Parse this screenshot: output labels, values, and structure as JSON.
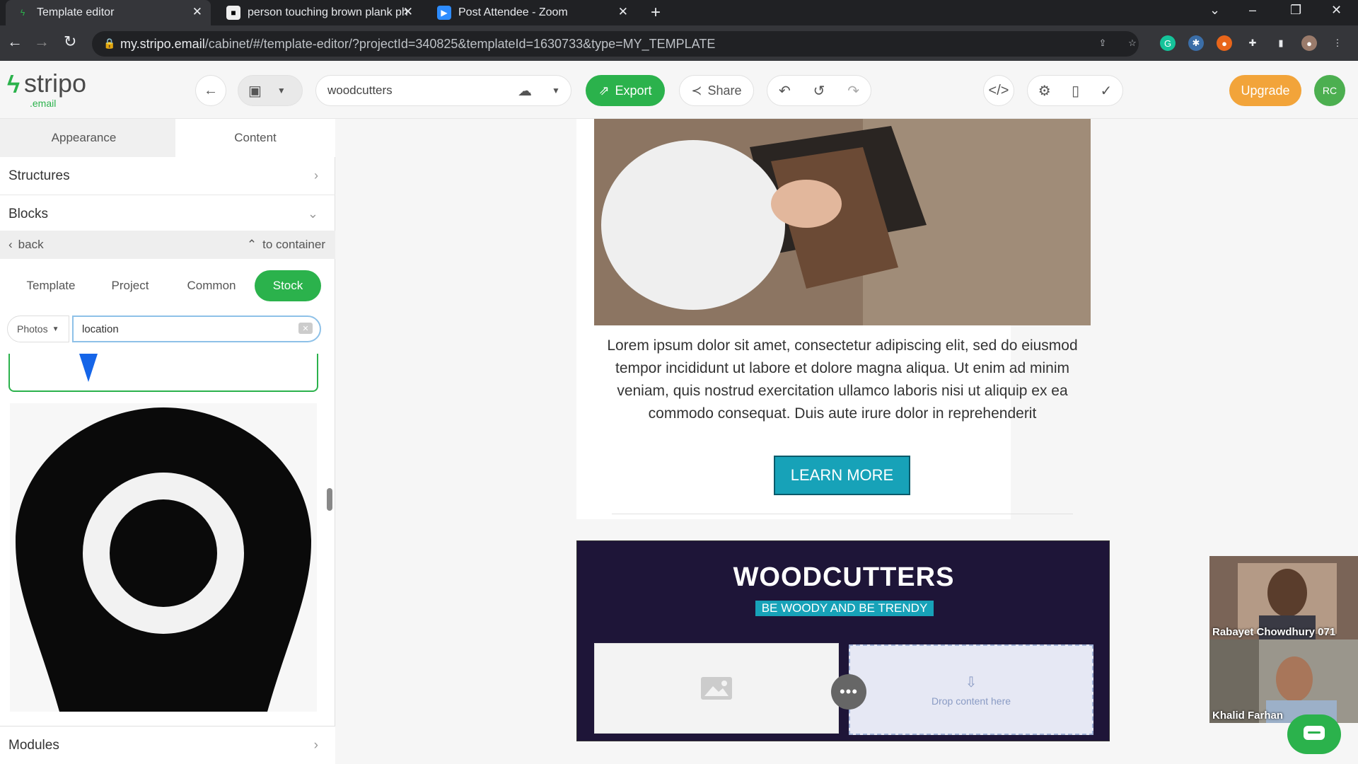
{
  "browser": {
    "tabs": [
      {
        "title": "Template editor",
        "active": true
      },
      {
        "title": "person touching brown plank ph",
        "active": false
      },
      {
        "title": "Post Attendee - Zoom",
        "active": false
      }
    ],
    "url_host": "my.stripo.email",
    "url_path": "/cabinet/#/template-editor/?projectId=340825&templateId=1630733&type=MY_TEMPLATE"
  },
  "app": {
    "logo_word": "stripo",
    "logo_sub": ".email",
    "template_name": "woodcutters",
    "export_label": "Export",
    "share_label": "Share",
    "upgrade_label": "Upgrade",
    "avatar_initials": "RC",
    "brand_color": "#2bb24c",
    "upgrade_color": "#f2a43a"
  },
  "sidebar": {
    "tabs": [
      "Appearance",
      "Content"
    ],
    "selected_tab": "Content",
    "structures_label": "Structures",
    "blocks_label": "Blocks",
    "back_label": "back",
    "to_container_label": "to container",
    "source_chips": [
      "Template",
      "Project",
      "Common",
      "Stock"
    ],
    "selected_chip": "Stock",
    "filter_type": "Photos",
    "search_value": "location",
    "modules_label": "Modules"
  },
  "email": {
    "body_text": "Lorem ipsum dolor sit amet, consectetur adipiscing elit, sed do eiusmod tempor incididunt ut labore et dolore magna aliqua. Ut enim ad minim veniam, quis nostrud exercitation ullamco laboris nisi ut aliquip ex ea commodo consequat. Duis aute irure dolor in reprehenderit",
    "button_label": "LEARN MORE",
    "footer_title": "WOODCUTTERS",
    "footer_tagline": "BE WOODY AND BE TRENDY",
    "drop_label": "Drop content here",
    "button_color": "#17a2b8",
    "footer_bg": "#1e1538"
  },
  "video": {
    "participants": [
      "Rabayet Chowdhury 071",
      "Khalid Farhan"
    ]
  }
}
